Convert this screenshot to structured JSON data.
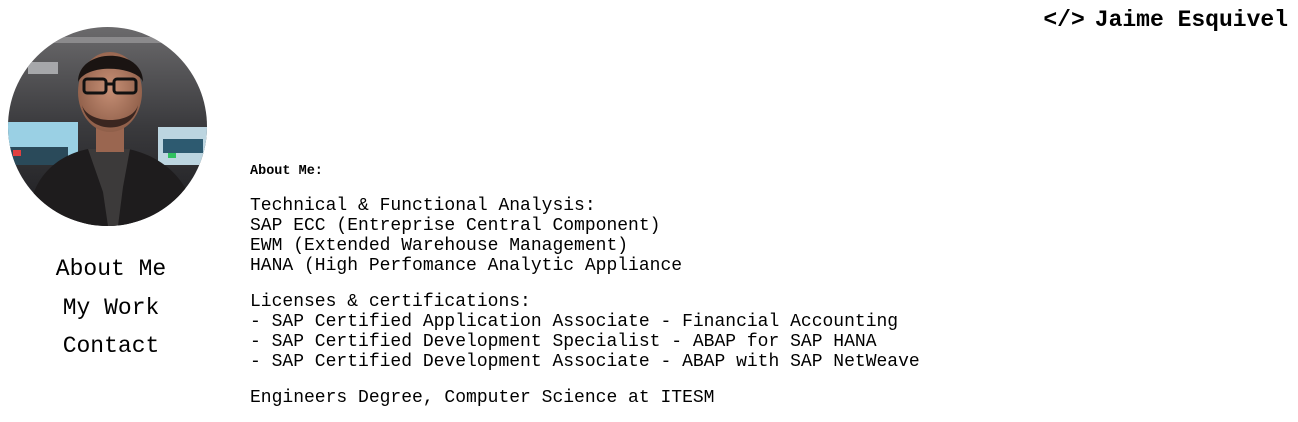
{
  "header": {
    "code_symbol": "</>",
    "name": "Jaime Esquivel"
  },
  "avatar": {
    "icon": "profile-photo"
  },
  "nav": {
    "items": [
      {
        "label": "About Me"
      },
      {
        "label": "My Work"
      },
      {
        "label": "Contact"
      }
    ]
  },
  "about": {
    "heading": "About Me:",
    "analysis": {
      "title": "Technical & Functional Analysis:",
      "items": [
        "SAP ECC (Entreprise Central Component)",
        "EWM (Extended Warehouse Management)",
        "HANA (High Perfomance Analytic Appliance"
      ]
    },
    "licenses": {
      "title": "Licenses & certifications:",
      "items": [
        "- SAP Certified Application Associate - Financial Accounting",
        "- SAP Certified Development Specialist - ABAP for SAP HANA",
        "- SAP Certified Development Associate - ABAP with SAP NetWeave"
      ]
    },
    "education": "Engineers Degree, Computer Science at ITESM"
  }
}
